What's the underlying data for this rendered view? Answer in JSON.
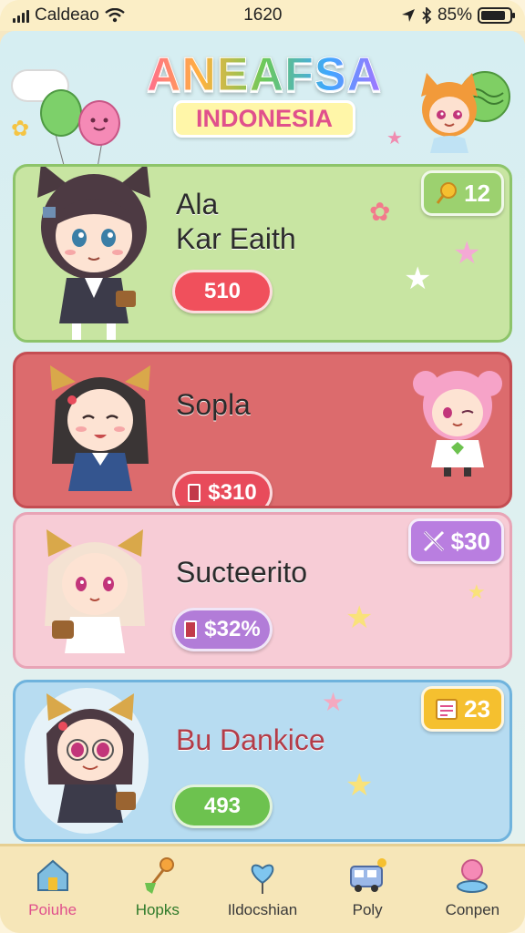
{
  "status": {
    "carrier": "Caldeao",
    "time": "1620",
    "battery": "85%",
    "battery_level": 0.85
  },
  "header": {
    "title": "ANEAFSA",
    "subtitle": "INDONESIA"
  },
  "cards": [
    {
      "name": "Ala Kar Eaith",
      "value": "510",
      "badge": "12",
      "badge_icon": "lollipop-icon",
      "color": "#c8e5a2"
    },
    {
      "name": "Sopla",
      "value": "310",
      "value_prefix": "$",
      "color": "#dc6b6d"
    },
    {
      "name": "Sucteerito",
      "value": "32%",
      "value_prefix": "$",
      "badge": "$30",
      "badge_icon": "crossed-swords-icon",
      "color": "#f7ccd6"
    },
    {
      "name": "Bu Dankice",
      "value": "493",
      "badge": "23",
      "badge_icon": "calendar-icon",
      "color": "#b7dcf1"
    }
  ],
  "nav": [
    {
      "label": "Poiuhe",
      "icon": "home-icon",
      "active": true
    },
    {
      "label": "Hopks",
      "icon": "wand-icon",
      "active": false
    },
    {
      "label": "Ildocshian",
      "icon": "heart-balloon-icon",
      "active": false
    },
    {
      "label": "Poly",
      "icon": "bus-icon",
      "active": false
    },
    {
      "label": "Conpen",
      "icon": "orb-icon",
      "active": false
    }
  ],
  "colors": {
    "accent": "#e0508c",
    "nav_bg": "#f6e6b8"
  }
}
